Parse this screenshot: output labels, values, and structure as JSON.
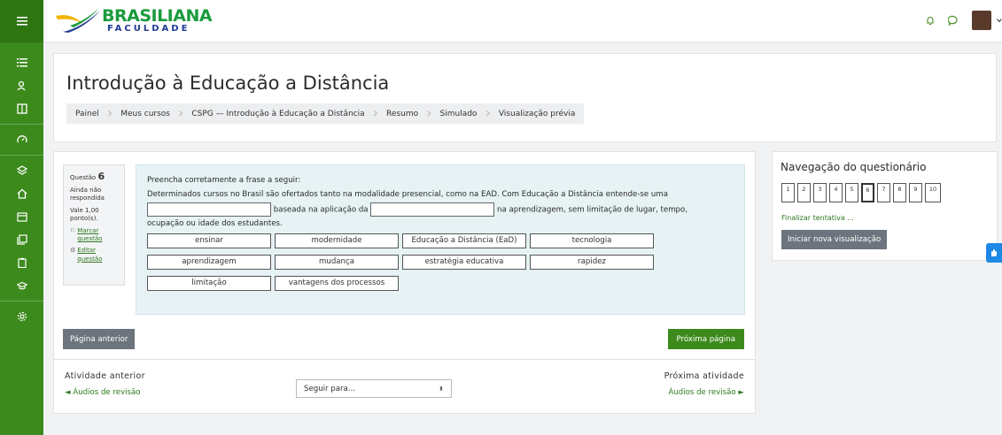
{
  "brand": {
    "line1": "BRASILIANA",
    "line2": "FACULDADE"
  },
  "page": {
    "title": "Introdução à Educação a Distância",
    "breadcrumbs": [
      "Painel",
      "Meus cursos",
      "CSPG — Introdução à Educação a Distância",
      "Resumo",
      "Simulado",
      "Visualização prévia"
    ]
  },
  "question_info": {
    "label": "Questão",
    "number": "6",
    "status": "Ainda não respondida",
    "points": "Vale 1,00 ponto(s).",
    "flag": "Marcar questão",
    "edit": "Editar questão"
  },
  "question": {
    "prompt": "Preencha corretamente a frase a seguir:",
    "text_part1": "Determinados cursos no Brasil são ofertados tanto na modalidade presencial, como na EAD. Com Educação a Distância entende-se uma",
    "text_part2": "baseada na aplicação da",
    "text_part3": "na aprendizagem, sem limitação de lugar, tempo,",
    "text_part4": "ocupação ou idade dos estudantes.",
    "choices": [
      "ensinar",
      "modernidade",
      "Educação a Distância (EaD)",
      "tecnologia",
      "aprendizagem",
      "mudança",
      "estratégia educativa",
      "rapidez",
      "limitação",
      "vantagens dos processos"
    ]
  },
  "buttons": {
    "prev_page": "Página anterior",
    "next_page": "Próxima página",
    "start_preview": "Iniciar nova visualização"
  },
  "activity_nav": {
    "prev_heading": "Atividade anterior",
    "prev_link": "◄ Áudios de revisão",
    "next_heading": "Próxima atividade",
    "next_link": "Áudios de revisão ►",
    "jump_placeholder": "Seguir para..."
  },
  "quiz_nav": {
    "title": "Navegação do questionário",
    "questions": [
      "1",
      "2",
      "3",
      "4",
      "5",
      "6",
      "7",
      "8",
      "9",
      "10"
    ],
    "current": "6",
    "finish": "Finalizar tentativa ..."
  },
  "colors": {
    "brand_green": "#3d8a1c",
    "link_green": "#2d7a1e",
    "secondary_gray": "#6c757d"
  }
}
